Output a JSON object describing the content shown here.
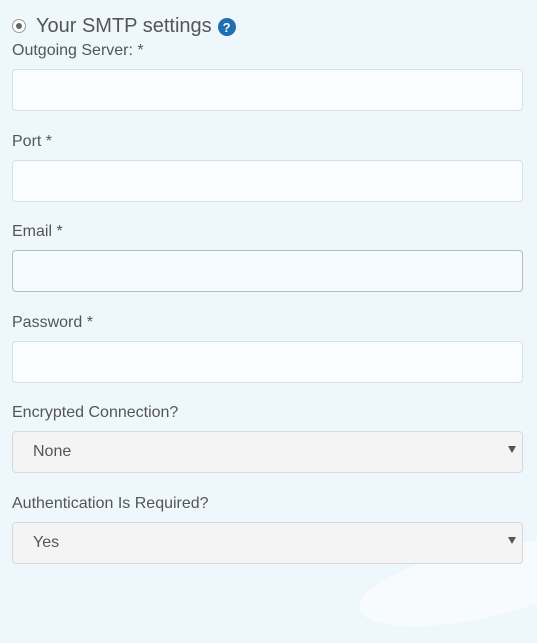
{
  "header": {
    "title": "Your SMTP settings",
    "help_icon": "?"
  },
  "fields": {
    "outgoing_server": {
      "label": "Outgoing Server: *",
      "value": ""
    },
    "port": {
      "label": "Port *",
      "value": ""
    },
    "email": {
      "label": "Email *",
      "value": ""
    },
    "password": {
      "label": "Password *",
      "value": ""
    }
  },
  "selects": {
    "encrypted_connection": {
      "label": "Encrypted Connection?",
      "value": "None"
    },
    "authentication_required": {
      "label": "Authentication Is Required?",
      "value": "Yes"
    }
  },
  "colors": {
    "accent": "#1f6fb3",
    "background": "#eef7fc"
  }
}
